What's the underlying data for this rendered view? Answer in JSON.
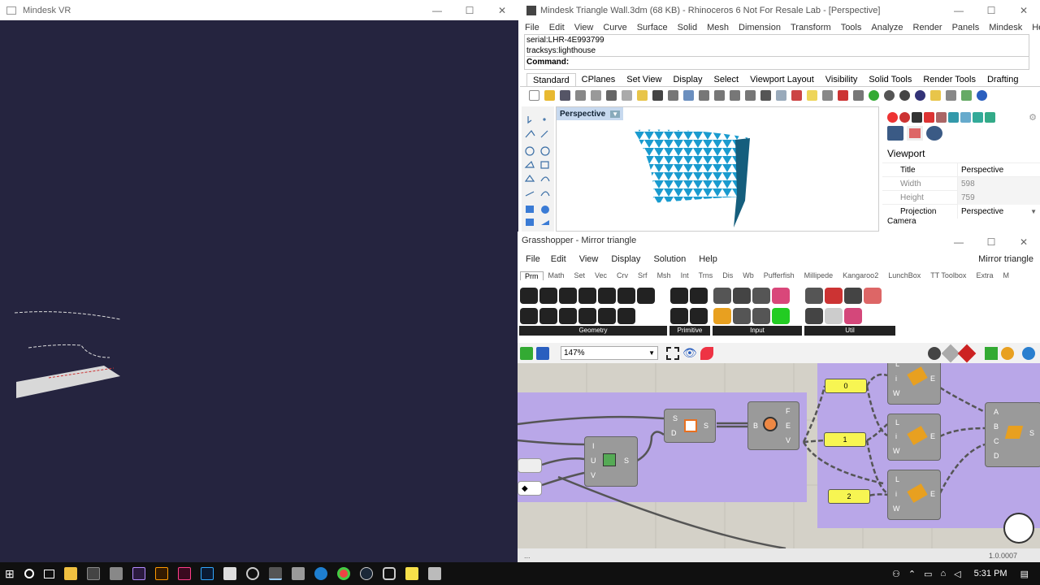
{
  "vr": {
    "title": "Mindesk VR",
    "bg": "#25243f"
  },
  "rhino": {
    "title": "Mindesk Triangle Wall.3dm (68 KB) - Rhinoceros 6 Not For Resale Lab - [Perspective]",
    "menu": [
      "File",
      "Edit",
      "View",
      "Curve",
      "Surface",
      "Solid",
      "Mesh",
      "Dimension",
      "Transform",
      "Tools",
      "Analyze",
      "Render",
      "Panels",
      "Mindesk",
      "Help"
    ],
    "cmd_lines": [
      "serial:LHR-4E993799",
      "tracksys:lighthouse"
    ],
    "cmd_label": "Command:",
    "tabs": [
      "Standard",
      "CPlanes",
      "Set View",
      "Display",
      "Select",
      "Viewport Layout",
      "Visibility",
      "Solid Tools",
      "Render Tools",
      "Drafting"
    ],
    "viewport_label": "Perspective",
    "props": {
      "heading": "Viewport",
      "rows": [
        [
          "Title",
          "Perspective"
        ],
        [
          "Width",
          "598"
        ],
        [
          "Height",
          "759"
        ],
        [
          "Projection",
          "Perspective"
        ]
      ],
      "cut": "Camera"
    }
  },
  "gh": {
    "title": "Grasshopper - Mirror triangle",
    "menu": [
      "File",
      "Edit",
      "View",
      "Display",
      "Solution",
      "Help"
    ],
    "doc": "Mirror triangle",
    "tabs": [
      "Prm",
      "Math",
      "Set",
      "Vec",
      "Crv",
      "Srf",
      "Msh",
      "Int",
      "Trns",
      "Dis",
      "Wb",
      "Pufferfish",
      "Millipede",
      "Kangaroo2",
      "LunchBox",
      "TT Toolbox",
      "Extra",
      "M"
    ],
    "groups": [
      "Geometry",
      "Primitive",
      "Input",
      "Util"
    ],
    "zoom": "147%",
    "panels": [
      "0",
      "1",
      "2"
    ],
    "version": "1.0.0007",
    "status_dots": "...",
    "canvas_bg": "#d4d1c8",
    "group_color": "#b9a7e8"
  },
  "taskbar": {
    "time": "5:31 PM"
  }
}
